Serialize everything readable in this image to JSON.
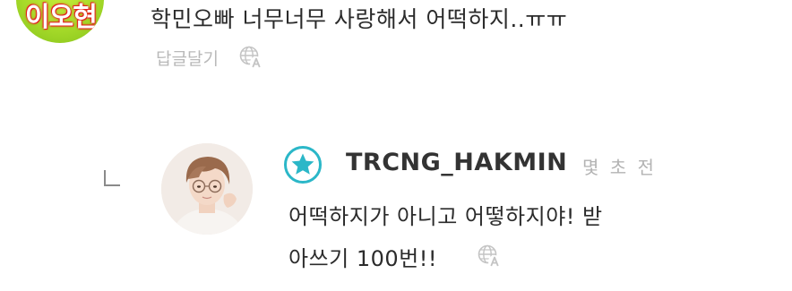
{
  "top_comment": {
    "avatar_text": "이오현",
    "text": "학민오빠 너무너무 사랑해서 어떡하지..ㅠㅠ",
    "reply_label": "답글달기",
    "colors": {
      "avatar_bg": "#a7db2a",
      "reply_label": "#b9b9b9"
    }
  },
  "reply_comment": {
    "username": "TRCNG_HAKMIN",
    "time": "몇 초 전",
    "text_line1": "어떡하지가 아니고 어떻하지야! 받",
    "text_line2": "아쓰기 100번!!",
    "badge_icon": "star-badge-icon",
    "colors": {
      "badge_accent": "#2bb7c8",
      "username": "#333333",
      "time": "#b3b3b3"
    }
  },
  "icons": {
    "translate": "globe-translate-icon",
    "reply_indent": "reply-corner-icon"
  }
}
